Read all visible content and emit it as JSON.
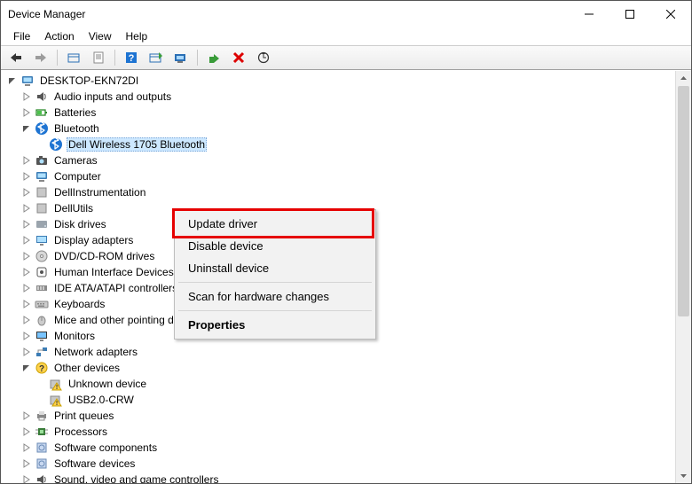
{
  "window": {
    "title": "Device Manager"
  },
  "menubar": [
    "File",
    "Action",
    "View",
    "Help"
  ],
  "toolbar": [
    {
      "name": "back-icon"
    },
    {
      "name": "forward-icon",
      "disabled": true
    },
    "sep",
    {
      "name": "show-hidden-icon"
    },
    {
      "name": "properties-icon"
    },
    "sep",
    {
      "name": "help-icon"
    },
    {
      "name": "legacy-icon"
    },
    {
      "name": "update-driver-icon"
    },
    "sep",
    {
      "name": "enable-icon"
    },
    {
      "name": "uninstall-icon"
    },
    {
      "name": "scan-hardware-icon"
    }
  ],
  "tree": {
    "root": {
      "label": "DESKTOP-EKN72DI",
      "icon": "computer-icon",
      "expanded": true
    },
    "items": [
      {
        "label": "Audio inputs and outputs",
        "icon": "audio-icon"
      },
      {
        "label": "Batteries",
        "icon": "battery-icon"
      },
      {
        "label": "Bluetooth",
        "icon": "bluetooth-icon",
        "expanded": true,
        "children": [
          {
            "label": "Dell Wireless 1705 Bluetooth",
            "icon": "bluetooth-icon",
            "selected": true
          }
        ]
      },
      {
        "label": "Cameras",
        "icon": "camera-icon"
      },
      {
        "label": "Computer",
        "icon": "computer-icon"
      },
      {
        "label": "DellInstrumentation",
        "icon": "generic-icon"
      },
      {
        "label": "DellUtils",
        "icon": "generic-icon"
      },
      {
        "label": "Disk drives",
        "icon": "disk-icon"
      },
      {
        "label": "Display adapters",
        "icon": "display-icon"
      },
      {
        "label": "DVD/CD-ROM drives",
        "icon": "cd-icon"
      },
      {
        "label": "Human Interface Devices",
        "icon": "hid-icon"
      },
      {
        "label": "IDE ATA/ATAPI controllers",
        "icon": "ide-icon"
      },
      {
        "label": "Keyboards",
        "icon": "keyboard-icon"
      },
      {
        "label": "Mice and other pointing devices",
        "icon": "mouse-icon"
      },
      {
        "label": "Monitors",
        "icon": "monitor-icon"
      },
      {
        "label": "Network adapters",
        "icon": "network-icon"
      },
      {
        "label": "Other devices",
        "icon": "other-icon",
        "expanded": true,
        "warning": true,
        "children": [
          {
            "label": "Unknown device",
            "icon": "warn-icon"
          },
          {
            "label": "USB2.0-CRW",
            "icon": "warn-icon"
          }
        ]
      },
      {
        "label": "Print queues",
        "icon": "printer-icon"
      },
      {
        "label": "Processors",
        "icon": "cpu-icon"
      },
      {
        "label": "Software components",
        "icon": "software-icon"
      },
      {
        "label": "Software devices",
        "icon": "software-icon"
      },
      {
        "label": "Sound, video and game controllers",
        "icon": "audio-icon"
      }
    ]
  },
  "context_menu": {
    "items": [
      {
        "label": "Update driver",
        "highlighted": true
      },
      {
        "label": "Disable device"
      },
      {
        "label": "Uninstall device"
      },
      "sep",
      {
        "label": "Scan for hardware changes"
      },
      "sep",
      {
        "label": "Properties",
        "bold": true
      }
    ]
  }
}
